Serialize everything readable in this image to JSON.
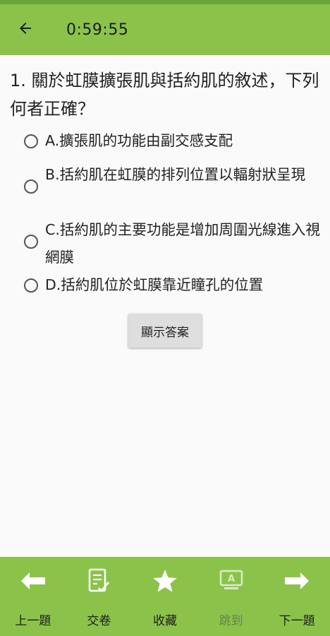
{
  "header": {
    "timer": "0:59:55"
  },
  "question": {
    "text": "1. 關於虹膜擴張肌與括約肌的敘述，下列何者正確？",
    "options": [
      {
        "label": "A.擴張肌的功能由副交感支配"
      },
      {
        "label": "B.括約肌在虹膜的排列位置以輻射狀呈現"
      },
      {
        "label": "C.括約肌的主要功能是增加周圍光線進入視網膜"
      },
      {
        "label": "D.括約肌位於虹膜靠近瞳孔的位置"
      }
    ]
  },
  "show_answer_label": "顯示答案",
  "bottom_nav": [
    {
      "label": "上一題",
      "icon": "arrow-left-icon"
    },
    {
      "label": "交卷",
      "icon": "submit-paper-icon"
    },
    {
      "label": "收藏",
      "icon": "star-icon"
    },
    {
      "label": "跳到",
      "icon": "jump-screen-icon",
      "disabled": true
    },
    {
      "label": "下一題",
      "icon": "arrow-right-icon"
    }
  ],
  "colors": {
    "primary": "#8bc34a",
    "primary_dark": "#6aa336",
    "background": "#fafafa"
  }
}
